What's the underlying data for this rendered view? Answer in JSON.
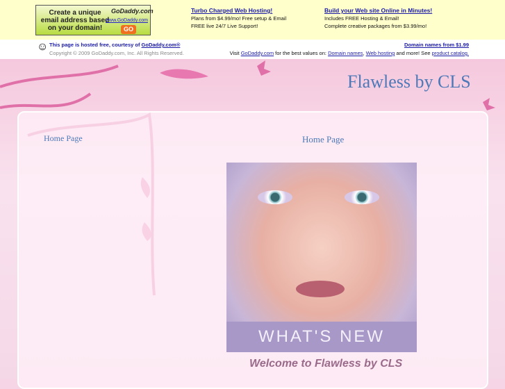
{
  "ad_banner": {
    "text": "Create a unique email address based on your domain!",
    "logo": "GoDaddy.com",
    "url": "www.GoDaddy.com",
    "go": "GO"
  },
  "promo1": {
    "title": "Turbo Charged Web Hosting!",
    "line1": "Plans from $4.99/mo! Free setup & Email",
    "line2": "FREE live 24/7 Live Support!"
  },
  "promo2": {
    "title": "Build your Web site Online in Minutes!",
    "line1": "Includes FREE Hosting & Email!",
    "line2": "Complete creative packages from $3.99/mo!"
  },
  "hosted": {
    "text": "This page is hosted free, courtesy of ",
    "link": "GoDaddy.com®",
    "copyright": "Copyright © 2009 GoDaddy.com, Inc. All Rights Reserved.",
    "domain_link": "Domain names from $1.99",
    "visit": "Visit ",
    "visit_link": "GoDaddy.com",
    "visit_mid": " for the best values on: ",
    "link_domains": "Domain names",
    "comma": ", ",
    "link_hosting": "Web hosting",
    "and_more": " and more! See ",
    "link_catalog": "product catalog."
  },
  "site": {
    "title": "Flawless by CLS",
    "nav": [
      "Home Page"
    ],
    "heading": "Home Page",
    "banner": "WHAT'S NEW",
    "welcome": "Welcome to Flawless by CLS"
  }
}
